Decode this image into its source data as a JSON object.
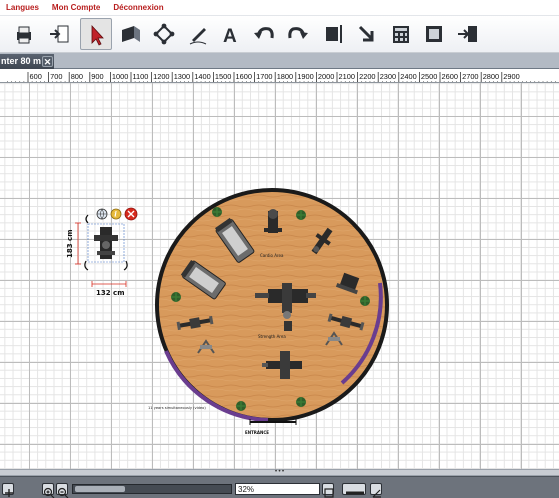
{
  "menu": {
    "items": [
      "Langues",
      "Mon Compte",
      "Déconnexion"
    ]
  },
  "toolbar": {
    "tools": [
      {
        "icon": "print-icon",
        "selected": false
      },
      {
        "icon": "import-icon",
        "selected": false
      },
      {
        "icon": "pointer-icon",
        "selected": true
      },
      {
        "icon": "extrude-icon",
        "selected": false
      },
      {
        "icon": "node-edit-icon",
        "selected": false
      },
      {
        "icon": "pen-icon",
        "selected": false
      },
      {
        "icon": "text-tool-icon",
        "selected": false
      },
      {
        "icon": "undo-icon",
        "selected": false
      },
      {
        "icon": "redo-icon",
        "selected": false
      },
      {
        "icon": "align-icon",
        "selected": false
      },
      {
        "icon": "arrow-down-icon",
        "selected": false
      },
      {
        "icon": "calculator-icon",
        "selected": false
      },
      {
        "icon": "fit-page-icon",
        "selected": false
      },
      {
        "icon": "exit-icon",
        "selected": false
      }
    ]
  },
  "tab": {
    "label": "nter 80 m",
    "close": "✕"
  },
  "ruler": {
    "ticks": [
      "600",
      "700",
      "800",
      "900",
      "1000",
      "1100",
      "1200",
      "1300",
      "1400",
      "1500",
      "1600",
      "1700",
      "1800",
      "1900",
      "2000",
      "2100",
      "2200",
      "2300",
      "2400",
      "2500",
      "2600",
      "2700",
      "2800",
      "2900"
    ]
  },
  "plan": {
    "cardio_area": "Cardio Area",
    "strength_area": "Strength Area",
    "entrance": "ENTRANCE",
    "note": "11 years simultaneously (video)"
  },
  "selection": {
    "height_label": "183 cm",
    "width_label": "132 cm"
  },
  "statusbar": {
    "zoom_value": "32%",
    "zoom_fraction": 0.32,
    "splitter_grip": "•••"
  },
  "colors": {
    "menu_text": "#b81e1e",
    "floor_wood": "#d89a5c",
    "floor_border": "#1a1a1a",
    "purple_arc": "#6a3d8f",
    "plant_green": "#2f5f2a",
    "delete_red": "#d62a1e"
  }
}
